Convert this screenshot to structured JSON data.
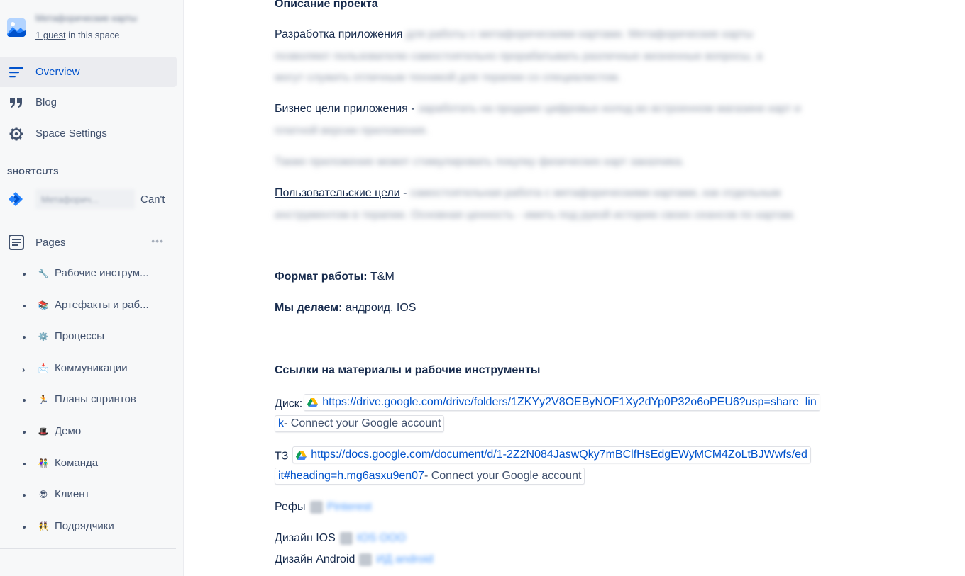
{
  "sidebar": {
    "space_name": "Метафорические карты",
    "guest_count": "1 guest",
    "guest_suffix": " in this space",
    "nav": [
      {
        "label": "Overview",
        "icon": "overview-lines-icon",
        "active": true
      },
      {
        "label": "Blog",
        "icon": "quote-icon",
        "active": false
      },
      {
        "label": "Space Settings",
        "icon": "gear-icon",
        "active": false
      }
    ],
    "shortcuts_label": "SHORTCUTS",
    "shortcut": {
      "name": "Метафорич...",
      "status": "Can't"
    },
    "pages_label": "Pages",
    "pages": [
      {
        "emoji": "🔧",
        "label": "Рабочие инструм...",
        "has_children": false
      },
      {
        "emoji": "📚",
        "label": "Артефакты и раб...",
        "has_children": false
      },
      {
        "emoji": "⚙️",
        "label": "Процессы",
        "has_children": false
      },
      {
        "emoji": "📩",
        "label": "Коммуникации",
        "has_children": true
      },
      {
        "emoji": "🏃",
        "label": "Планы спринтов",
        "has_children": false
      },
      {
        "emoji": "🎩",
        "label": "Демо",
        "has_children": false
      },
      {
        "emoji": "👫",
        "label": "Команда",
        "has_children": false
      },
      {
        "emoji": "😎",
        "label": "Клиент",
        "has_children": false
      },
      {
        "emoji": "👯",
        "label": "Подрядчики",
        "has_children": false
      }
    ]
  },
  "content": {
    "heading_description": "Описание проекта",
    "dev_label": "Разработка приложения",
    "dev_blur_1": "для работы с метафорическими картами. Метафорические карты",
    "dev_blur_2": "позволяют пользователю самостоятельно прорабатывать различные жизненные вопросы, а",
    "dev_blur_3": "могут служить отличным техникой для терапии со специалистом.",
    "biz_label": "Бизнес цели приложения",
    "dash": " -",
    "biz_blur_1": "заработать на продаже цифровых колод во встроенном магазине карт и",
    "biz_blur_2": "платной версии приложения.",
    "extra_blur": "Также приложение может стимулировать покупку физических карт заказчика.",
    "user_label": "Пользовательские цели",
    "user_blur_1": "самостоятельная работа с метафорическими картами, как отдельным",
    "user_blur_2": "инструментом в терапии. Основная ценность - иметь под рукой историю своих сеансов по картам.",
    "format_label": "Формат работы:",
    "format_value": " T&M",
    "do_label": "Мы делаем:",
    "do_value": " андроид, IOS",
    "links_heading": "Ссылки на материалы и рабочие инструменты",
    "disk_label": "Диск:",
    "disk_url_1": "https://drive.google.com/drive/folders/1ZKYy2V8OEByNOF1Xy2dYp0P32o6oPEU6?usp=share_lin",
    "disk_url_2": "k",
    "connect_text": " - Connect your Google account",
    "tz_label": "ТЗ",
    "tz_url_1": "https://docs.google.com/document/d/1-2Z2N084JaswQky7mBClfHsEdgEWyMCM4ZoLtBJWwfs/ed",
    "tz_url_2": "it#heading=h.mg6asxu9en07",
    "refs_label": "Рефы",
    "refs_link": "Pinterest",
    "ios_label": "Дизайн IOS",
    "ios_link": "IOS ООО",
    "android_label": "Дизайн Android",
    "android_link": "ИД android"
  },
  "colors": {
    "accent": "#0052cc",
    "text": "#172b4d",
    "sidebar_bg": "#f7f8f9",
    "active_bg": "#ebecf0"
  }
}
